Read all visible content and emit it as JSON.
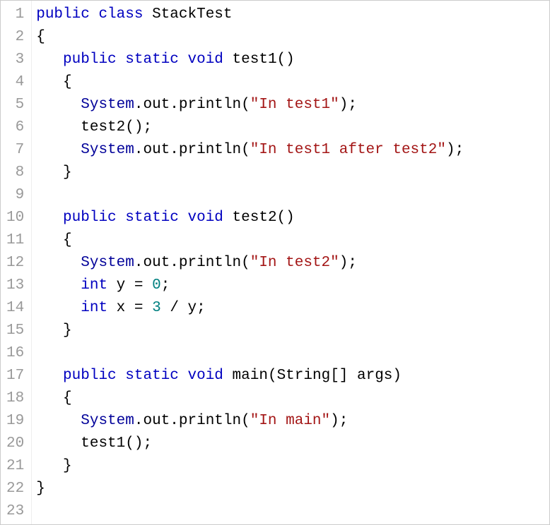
{
  "colors": {
    "keyword": "#0000c0",
    "string": "#a31515",
    "number": "#008080",
    "default": "#000000",
    "gutter": "#999999"
  },
  "code": {
    "lines": [
      {
        "num": "1",
        "tokens": [
          {
            "t": "kw",
            "v": "public"
          },
          {
            "t": "sp",
            "v": " "
          },
          {
            "t": "kw",
            "v": "class"
          },
          {
            "t": "sp",
            "v": " "
          },
          {
            "t": "cls",
            "v": "StackTest"
          }
        ]
      },
      {
        "num": "2",
        "tokens": [
          {
            "t": "punct",
            "v": "{"
          }
        ]
      },
      {
        "num": "3",
        "tokens": [
          {
            "t": "sp",
            "v": "   "
          },
          {
            "t": "kw",
            "v": "public"
          },
          {
            "t": "sp",
            "v": " "
          },
          {
            "t": "kw",
            "v": "static"
          },
          {
            "t": "sp",
            "v": " "
          },
          {
            "t": "kw",
            "v": "void"
          },
          {
            "t": "sp",
            "v": " "
          },
          {
            "t": "id",
            "v": "test1"
          },
          {
            "t": "punct",
            "v": "()"
          }
        ]
      },
      {
        "num": "4",
        "tokens": [
          {
            "t": "sp",
            "v": "   "
          },
          {
            "t": "punct",
            "v": "{"
          }
        ]
      },
      {
        "num": "5",
        "tokens": [
          {
            "t": "sp",
            "v": "     "
          },
          {
            "t": "sys",
            "v": "System"
          },
          {
            "t": "punct",
            "v": "."
          },
          {
            "t": "id",
            "v": "out"
          },
          {
            "t": "punct",
            "v": "."
          },
          {
            "t": "method",
            "v": "println"
          },
          {
            "t": "punct",
            "v": "("
          },
          {
            "t": "str",
            "v": "\"In test1\""
          },
          {
            "t": "punct",
            "v": ");"
          }
        ]
      },
      {
        "num": "6",
        "tokens": [
          {
            "t": "sp",
            "v": "     "
          },
          {
            "t": "id",
            "v": "test2"
          },
          {
            "t": "punct",
            "v": "();"
          }
        ]
      },
      {
        "num": "7",
        "tokens": [
          {
            "t": "sp",
            "v": "     "
          },
          {
            "t": "sys",
            "v": "System"
          },
          {
            "t": "punct",
            "v": "."
          },
          {
            "t": "id",
            "v": "out"
          },
          {
            "t": "punct",
            "v": "."
          },
          {
            "t": "method",
            "v": "println"
          },
          {
            "t": "punct",
            "v": "("
          },
          {
            "t": "str",
            "v": "\"In test1 after test2\""
          },
          {
            "t": "punct",
            "v": ");"
          }
        ]
      },
      {
        "num": "8",
        "tokens": [
          {
            "t": "sp",
            "v": "   "
          },
          {
            "t": "punct",
            "v": "}"
          }
        ]
      },
      {
        "num": "9",
        "tokens": []
      },
      {
        "num": "10",
        "tokens": [
          {
            "t": "sp",
            "v": "   "
          },
          {
            "t": "kw",
            "v": "public"
          },
          {
            "t": "sp",
            "v": " "
          },
          {
            "t": "kw",
            "v": "static"
          },
          {
            "t": "sp",
            "v": " "
          },
          {
            "t": "kw",
            "v": "void"
          },
          {
            "t": "sp",
            "v": " "
          },
          {
            "t": "id",
            "v": "test2"
          },
          {
            "t": "punct",
            "v": "()"
          }
        ]
      },
      {
        "num": "11",
        "tokens": [
          {
            "t": "sp",
            "v": "   "
          },
          {
            "t": "punct",
            "v": "{"
          }
        ]
      },
      {
        "num": "12",
        "tokens": [
          {
            "t": "sp",
            "v": "     "
          },
          {
            "t": "sys",
            "v": "System"
          },
          {
            "t": "punct",
            "v": "."
          },
          {
            "t": "id",
            "v": "out"
          },
          {
            "t": "punct",
            "v": "."
          },
          {
            "t": "method",
            "v": "println"
          },
          {
            "t": "punct",
            "v": "("
          },
          {
            "t": "str",
            "v": "\"In test2\""
          },
          {
            "t": "punct",
            "v": ");"
          }
        ]
      },
      {
        "num": "13",
        "tokens": [
          {
            "t": "sp",
            "v": "     "
          },
          {
            "t": "kw",
            "v": "int"
          },
          {
            "t": "sp",
            "v": " "
          },
          {
            "t": "id",
            "v": "y"
          },
          {
            "t": "sp",
            "v": " "
          },
          {
            "t": "op",
            "v": "="
          },
          {
            "t": "sp",
            "v": " "
          },
          {
            "t": "num",
            "v": "0"
          },
          {
            "t": "punct",
            "v": ";"
          }
        ]
      },
      {
        "num": "14",
        "tokens": [
          {
            "t": "sp",
            "v": "     "
          },
          {
            "t": "kw",
            "v": "int"
          },
          {
            "t": "sp",
            "v": " "
          },
          {
            "t": "id",
            "v": "x"
          },
          {
            "t": "sp",
            "v": " "
          },
          {
            "t": "op",
            "v": "="
          },
          {
            "t": "sp",
            "v": " "
          },
          {
            "t": "num",
            "v": "3"
          },
          {
            "t": "sp",
            "v": " "
          },
          {
            "t": "op",
            "v": "/"
          },
          {
            "t": "sp",
            "v": " "
          },
          {
            "t": "id",
            "v": "y"
          },
          {
            "t": "punct",
            "v": ";"
          }
        ]
      },
      {
        "num": "15",
        "tokens": [
          {
            "t": "sp",
            "v": "   "
          },
          {
            "t": "punct",
            "v": "}"
          }
        ]
      },
      {
        "num": "16",
        "tokens": []
      },
      {
        "num": "17",
        "tokens": [
          {
            "t": "sp",
            "v": "   "
          },
          {
            "t": "kw",
            "v": "public"
          },
          {
            "t": "sp",
            "v": " "
          },
          {
            "t": "kw",
            "v": "static"
          },
          {
            "t": "sp",
            "v": " "
          },
          {
            "t": "kw",
            "v": "void"
          },
          {
            "t": "sp",
            "v": " "
          },
          {
            "t": "id",
            "v": "main"
          },
          {
            "t": "punct",
            "v": "("
          },
          {
            "t": "cls",
            "v": "String"
          },
          {
            "t": "punct",
            "v": "[] "
          },
          {
            "t": "id",
            "v": "args"
          },
          {
            "t": "punct",
            "v": ")"
          }
        ]
      },
      {
        "num": "18",
        "tokens": [
          {
            "t": "sp",
            "v": "   "
          },
          {
            "t": "punct",
            "v": "{"
          }
        ]
      },
      {
        "num": "19",
        "tokens": [
          {
            "t": "sp",
            "v": "     "
          },
          {
            "t": "sys",
            "v": "System"
          },
          {
            "t": "punct",
            "v": "."
          },
          {
            "t": "id",
            "v": "out"
          },
          {
            "t": "punct",
            "v": "."
          },
          {
            "t": "method",
            "v": "println"
          },
          {
            "t": "punct",
            "v": "("
          },
          {
            "t": "str",
            "v": "\"In main\""
          },
          {
            "t": "punct",
            "v": ");"
          }
        ]
      },
      {
        "num": "20",
        "tokens": [
          {
            "t": "sp",
            "v": "     "
          },
          {
            "t": "id",
            "v": "test1"
          },
          {
            "t": "punct",
            "v": "();"
          }
        ]
      },
      {
        "num": "21",
        "tokens": [
          {
            "t": "sp",
            "v": "   "
          },
          {
            "t": "punct",
            "v": "}"
          }
        ]
      },
      {
        "num": "22",
        "tokens": [
          {
            "t": "punct",
            "v": "}"
          }
        ]
      },
      {
        "num": "23",
        "tokens": []
      }
    ]
  }
}
